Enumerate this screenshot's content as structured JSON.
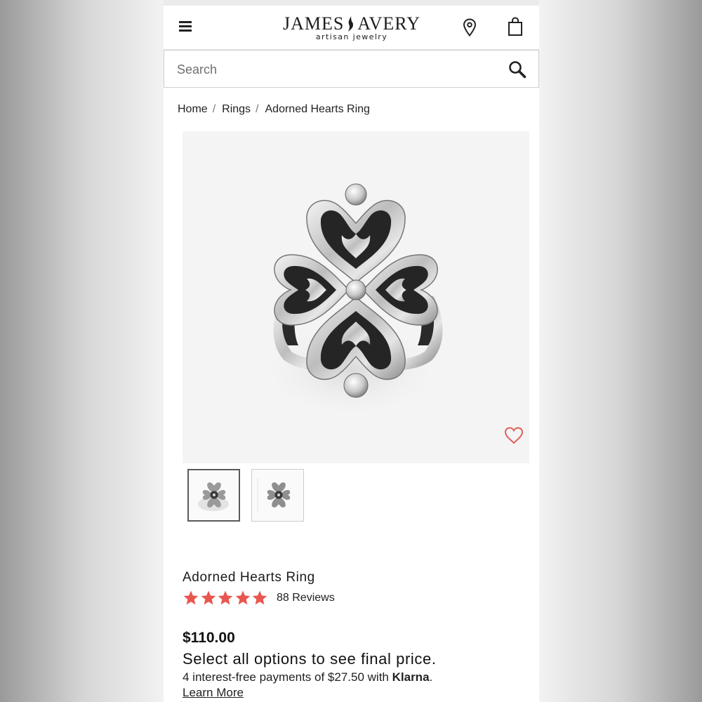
{
  "header": {
    "logo_main_left": "JAMES",
    "logo_main_right": "AVERY",
    "logo_sub": "artisan jewelry",
    "icons": [
      "menu-icon",
      "location-pin-icon",
      "shopping-bag-icon"
    ]
  },
  "search": {
    "placeholder": "Search",
    "value": "",
    "icon": "search-icon"
  },
  "breadcrumb": [
    "Home",
    "Rings",
    "Adorned Hearts Ring"
  ],
  "breadcrumb_separator": "/",
  "product": {
    "name": "Adorned Hearts Ring",
    "rating": 5,
    "rating_max": 5,
    "reviews_label": "88 Reviews",
    "price": "$110.00",
    "select_note": "Select all options to see final price.",
    "installments_prefix": "4 interest-free payments of $27.50 with ",
    "installments_brand": "Klarna",
    "installments_suffix": ".",
    "learn_more": "Learn More",
    "thumbnails": 2,
    "selected_thumbnail": 1
  },
  "colors": {
    "star": "#e8574f",
    "wishlist": "#e0605a",
    "text": "#1b1b1b"
  }
}
